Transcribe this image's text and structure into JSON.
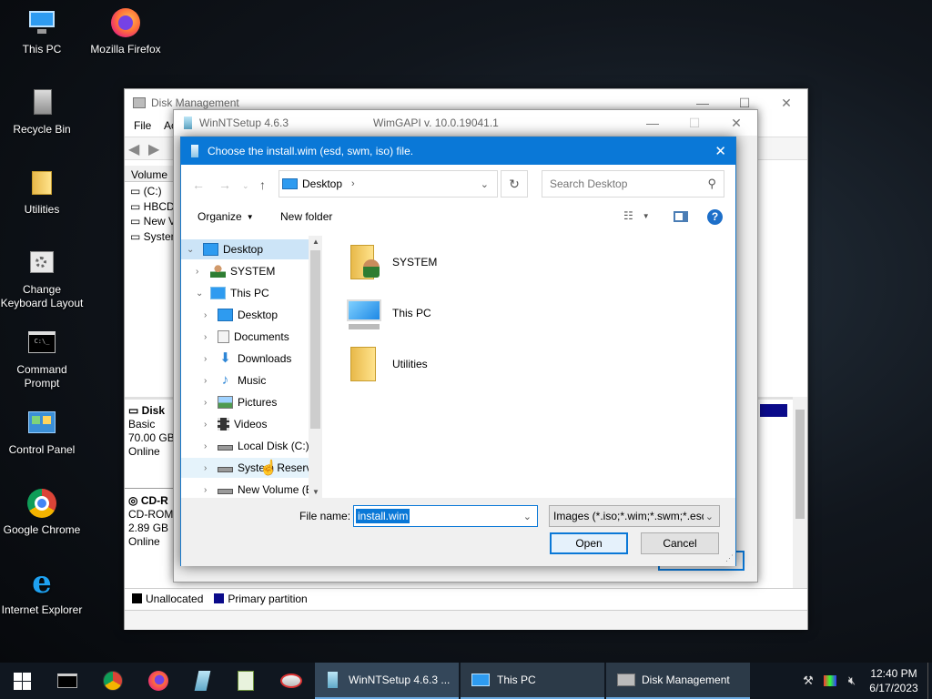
{
  "desktop": {
    "icons": [
      {
        "label": "This PC"
      },
      {
        "label": "Mozilla Firefox"
      },
      {
        "label": "Recycle Bin"
      },
      {
        "label": "Utilities"
      },
      {
        "label": "Change Keyboard Layout"
      },
      {
        "label": "Command Prompt"
      },
      {
        "label": "Control Panel"
      },
      {
        "label": "Google Chrome"
      },
      {
        "label": "Internet Explorer"
      }
    ]
  },
  "disk_mgmt": {
    "title": "Disk Management",
    "menu_file": "File",
    "menu_action": "Ac",
    "col_volume": "Volume",
    "volumes": [
      "(C:)",
      "HBCD",
      "New V",
      "Systen"
    ],
    "disk0": {
      "name": "Disk",
      "type": "Basic",
      "size": "70.00 GB",
      "status": "Online"
    },
    "cdrom": {
      "name": "CD-R",
      "type": "CD-ROM",
      "size": "2.89 GB",
      "status": "Online"
    },
    "legend_unallocated": "Unallocated",
    "legend_primary": "Primary partition"
  },
  "winnt": {
    "title": "WinNTSetup 4.6.3",
    "wimgapi": "WimGAPI v. 10.0.19041.1"
  },
  "dialog": {
    "title": "Choose the install.wim (esd, swm, iso) file.",
    "address": "Desktop",
    "search_placeholder": "Search Desktop",
    "organize": "Organize",
    "new_folder": "New folder",
    "tree": [
      {
        "label": "Desktop",
        "selected": true
      },
      {
        "label": "SYSTEM"
      },
      {
        "label": "This PC"
      },
      {
        "label": "Desktop"
      },
      {
        "label": "Documents"
      },
      {
        "label": "Downloads"
      },
      {
        "label": "Music"
      },
      {
        "label": "Pictures"
      },
      {
        "label": "Videos"
      },
      {
        "label": "Local Disk (C:)"
      },
      {
        "label": "System Reserve"
      },
      {
        "label": "New Volume (E"
      }
    ],
    "items": [
      {
        "label": "SYSTEM"
      },
      {
        "label": "This PC"
      },
      {
        "label": "Utilities"
      }
    ],
    "filename_label": "File name:",
    "filename_value": "install.wim",
    "filter": "Images (*.iso;*.wim;*.swm;*.esd",
    "open": "Open",
    "cancel": "Cancel"
  },
  "taskbar": {
    "tasks": [
      {
        "label": "WinNTSetup 4.6.3 ..."
      },
      {
        "label": "This PC"
      },
      {
        "label": "Disk Management"
      }
    ],
    "time": "12:40 PM",
    "date": "6/17/2023"
  },
  "colors": {
    "accent": "#0a78d7",
    "taskbar": "#101720",
    "selection": "#cce4f7"
  }
}
